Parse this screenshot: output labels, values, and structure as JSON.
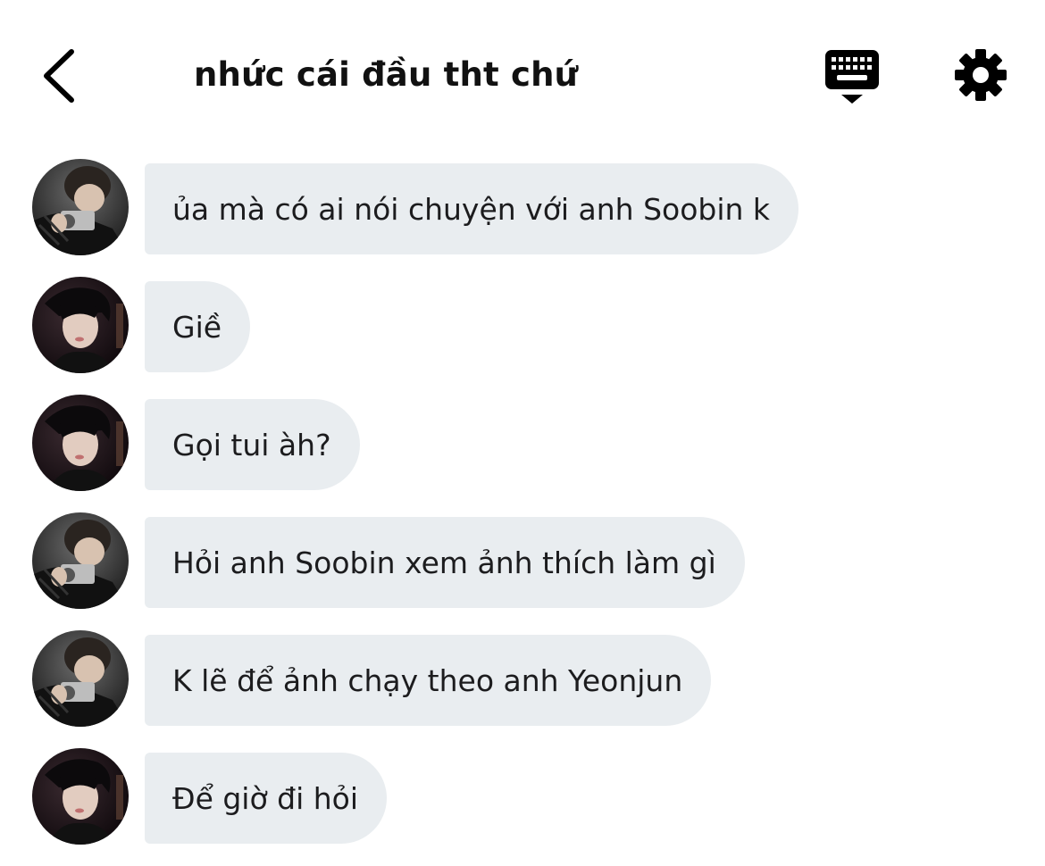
{
  "header": {
    "title": "nhức cái đầu tht chứ",
    "back_icon": "chevron-left-icon",
    "keyboard_icon": "keyboard-dismiss-icon",
    "settings_icon": "gear-icon"
  },
  "colors": {
    "bubble_bg": "#e9edf0",
    "text": "#1c1c1e",
    "icon": "#000000"
  },
  "messages": [
    {
      "text": "ủa mà có ai nói chuyện với anh Soobin k",
      "avatar": "avatar-a"
    },
    {
      "text": "Giề",
      "avatar": "avatar-b"
    },
    {
      "text": "Gọi tui àh?",
      "avatar": "avatar-b"
    },
    {
      "text": "Hỏi anh Soobin xem ảnh thích làm gì",
      "avatar": "avatar-a"
    },
    {
      "text": "K lẽ để ảnh chạy theo anh Yeonjun",
      "avatar": "avatar-a"
    },
    {
      "text": "Để giờ đi hỏi",
      "avatar": "avatar-b"
    }
  ]
}
